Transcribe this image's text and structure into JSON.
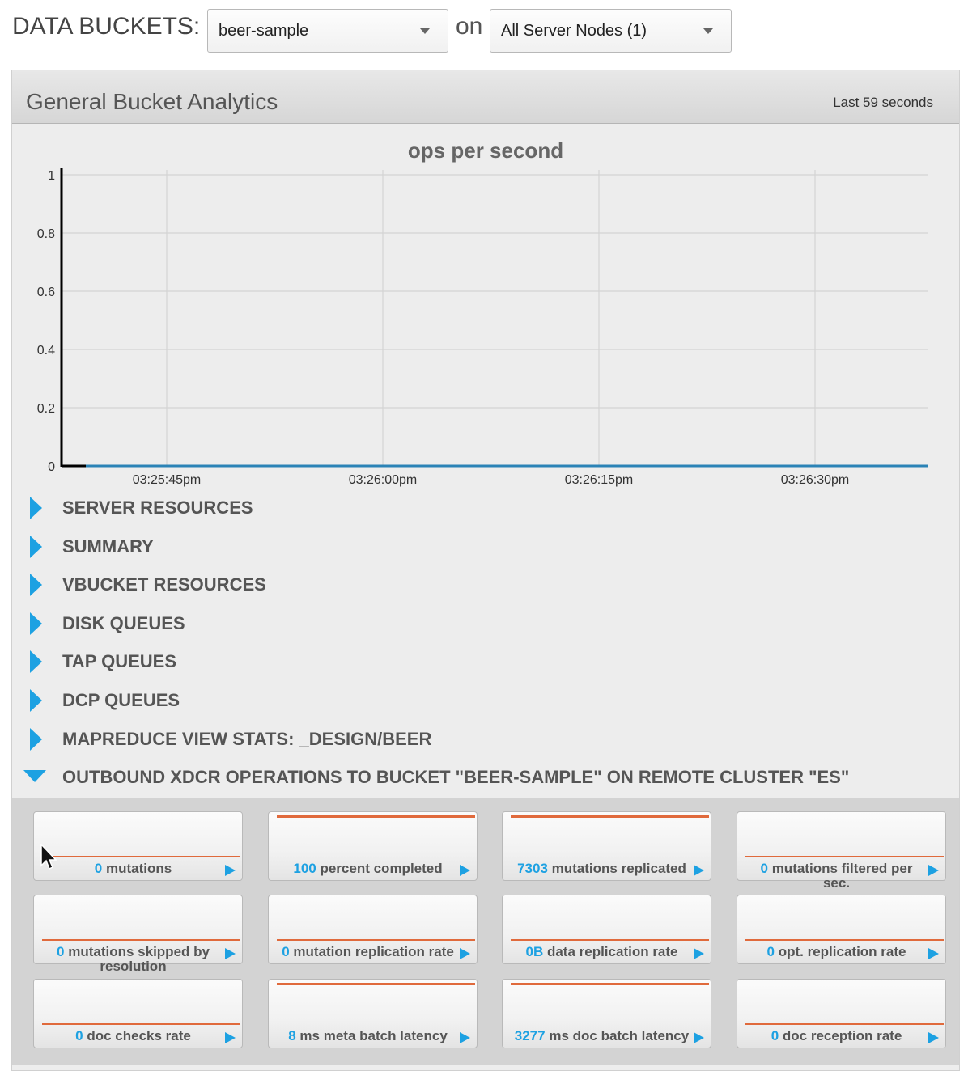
{
  "toolbar": {
    "label": "DATA BUCKETS:",
    "bucket_select": "beer-sample",
    "on_label": "on",
    "nodes_select": "All Server Nodes (1)"
  },
  "panel": {
    "title": "General Bucket Analytics",
    "range": "Last 59 seconds"
  },
  "chart_data": {
    "type": "line",
    "title": "ops per second",
    "xlabel": "",
    "ylabel": "",
    "ylim": [
      0,
      1
    ],
    "yticks": [
      "0",
      "0.2",
      "0.4",
      "0.6",
      "0.8",
      "1"
    ],
    "xticks": [
      "03:25:45pm",
      "03:26:00pm",
      "03:26:15pm",
      "03:26:30pm"
    ],
    "grid": true,
    "series": [
      {
        "x": [
          "03:25:36pm",
          "03:26:35pm"
        ],
        "values": [
          0,
          0
        ]
      }
    ],
    "colors": {
      "line": "#2b83b6",
      "grid": "#d4d4d4",
      "axis": "#000000"
    }
  },
  "sections": [
    {
      "label": "SERVER RESOURCES",
      "expanded": false
    },
    {
      "label": "SUMMARY",
      "expanded": false
    },
    {
      "label": "VBUCKET RESOURCES",
      "expanded": false
    },
    {
      "label": "DISK QUEUES",
      "expanded": false
    },
    {
      "label": "TAP QUEUES",
      "expanded": false
    },
    {
      "label": "DCP QUEUES",
      "expanded": false
    },
    {
      "label": "MAPREDUCE VIEW STATS: _DESIGN/BEER",
      "expanded": false
    },
    {
      "label": "OUTBOUND XDCR OPERATIONS TO BUCKET \"BEER-SAMPLE\" ON REMOTE CLUSTER \"ES\"",
      "expanded": true
    }
  ],
  "tiles": [
    {
      "value": "0",
      "text": "mutations",
      "spark": "low"
    },
    {
      "value": "100",
      "text": "percent completed",
      "spark": "high"
    },
    {
      "value": "7303",
      "text": "mutations replicated",
      "spark": "high"
    },
    {
      "value": "0",
      "text": "mutations filtered per sec.",
      "spark": "low"
    },
    {
      "value": "0",
      "text": "mutations skipped by resolution",
      "spark": "low"
    },
    {
      "value": "0",
      "text": "mutation replication rate",
      "spark": "low"
    },
    {
      "value": "0B",
      "text": "data replication rate",
      "spark": "low"
    },
    {
      "value": "0",
      "text": "opt. replication rate",
      "spark": "low"
    },
    {
      "value": "0",
      "text": "doc checks rate",
      "spark": "low"
    },
    {
      "value": "8",
      "text": "ms meta batch latency",
      "spark": "high"
    },
    {
      "value": "3277",
      "text": "ms doc batch latency",
      "spark": "high"
    },
    {
      "value": "0",
      "text": "doc reception rate",
      "spark": "low"
    }
  ],
  "icons": {
    "section_collapsed": "triangle-right-icon",
    "section_expanded": "triangle-down-icon",
    "tile_arrow": "play-arrow-icon",
    "select_caret": "chevron-down-icon",
    "cursor": "mouse-pointer-icon"
  },
  "accent": "#1da1e2",
  "spark_color": "#e06a3c"
}
